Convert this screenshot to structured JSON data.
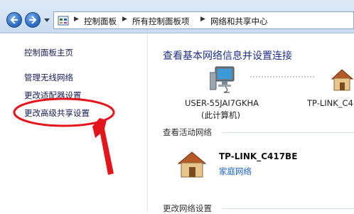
{
  "address_bar": {
    "breadcrumbs": [
      {
        "label": "控制面板"
      },
      {
        "label": "所有控制面板项"
      },
      {
        "label": "网络和共享中心"
      }
    ]
  },
  "left_pane": {
    "home_link": "控制面板主页",
    "links": [
      {
        "label": "管理无线网络"
      },
      {
        "label": "更改适配器设置"
      },
      {
        "label": "更改高级共享设置"
      }
    ]
  },
  "main": {
    "title": "查看基本网络信息并设置连接",
    "computer_name": "USER-55JAI7GKHA",
    "computer_sub": "(此计算机)",
    "network_node_name": "TP-LINK_C4",
    "active_networks_header": "查看活动网络",
    "active_network": {
      "name": "TP-LINK_C417BE",
      "type": "家庭网络"
    },
    "change_settings_header": "更改网络设置"
  },
  "colors": {
    "link": "#151c55",
    "title": "#1e3287",
    "annotation_red": "#e5161b",
    "network_type": "#1a62c8"
  },
  "annotation": {
    "highlighted_item": "更改高级共享设置"
  }
}
